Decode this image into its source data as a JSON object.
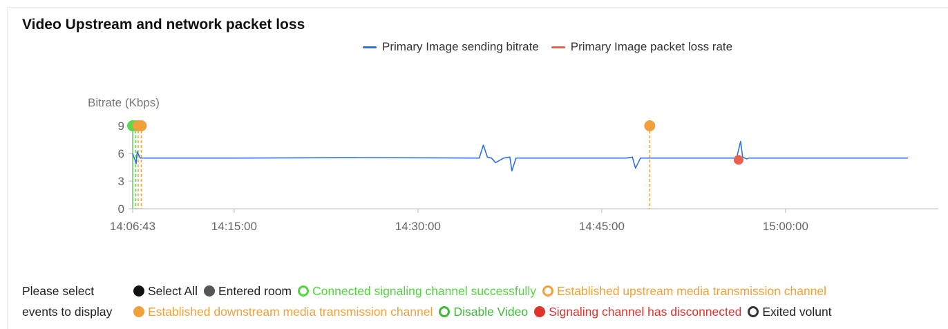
{
  "panel": {
    "title": "Video Upstream and network packet loss"
  },
  "legend": [
    {
      "label": "Primary Image sending bitrate",
      "color": "#2f6fe0"
    },
    {
      "label": "Primary Image packet loss rate",
      "color": "#e8614f"
    }
  ],
  "chart_data": {
    "type": "line",
    "ylabel": "Bitrate (Kbps)",
    "ylim": [
      0,
      9
    ],
    "yticks": [
      0,
      3,
      6,
      9
    ],
    "xlim": [
      "14:06:43",
      "15:10:00"
    ],
    "xticks": [
      "14:06:43",
      "14:15:00",
      "14:30:00",
      "14:45:00",
      "15:00:00"
    ],
    "series": [
      {
        "name": "Primary Image sending bitrate",
        "color": "#2f6fe0",
        "x": [
          "14:06:43",
          "14:07:00",
          "14:07:05",
          "14:07:20",
          "14:08:00",
          "14:15:00",
          "14:25:00",
          "14:35:00",
          "14:35:20",
          "14:35:40",
          "14:36:00",
          "14:36:20",
          "14:37:00",
          "14:37:30",
          "14:37:40",
          "14:38:00",
          "14:45:00",
          "14:47:00",
          "14:47:30",
          "14:47:45",
          "14:48:10",
          "14:50:00",
          "14:55:00",
          "14:56:00",
          "14:56:20",
          "14:56:30",
          "14:56:50",
          "14:57:00",
          "15:00:00",
          "15:05:00",
          "15:10:00"
        ],
        "y": [
          6.0,
          4.9,
          6.2,
          5.5,
          5.5,
          5.5,
          5.55,
          5.5,
          6.9,
          5.6,
          5.5,
          5.0,
          5.5,
          5.6,
          4.1,
          5.5,
          5.5,
          5.5,
          5.6,
          4.4,
          5.5,
          5.5,
          5.5,
          5.5,
          7.3,
          5.6,
          5.4,
          5.5,
          5.5,
          5.5,
          5.5
        ]
      },
      {
        "name": "Primary Image packet loss rate",
        "color": "#e8614f",
        "x": [
          "14:56:10"
        ],
        "y": [
          5.3
        ]
      }
    ],
    "event_markers": [
      {
        "time": "14:06:43",
        "color": "#5dd84c",
        "line": "solid"
      },
      {
        "time": "14:06:57",
        "color": "#5dd84c",
        "line": "dashed"
      },
      {
        "time": "14:07:10",
        "color": "#f0a13a",
        "line": "dashed"
      },
      {
        "time": "14:07:25",
        "color": "#f0a13a",
        "line": "dashed"
      },
      {
        "time": "14:48:55",
        "color": "#f0a13a",
        "line": "dashed"
      }
    ],
    "grid": false
  },
  "events": {
    "label_line1": "Please select",
    "label_line2": "events to display",
    "row1": [
      {
        "label": "Select All",
        "color": "#111111",
        "style": "filled"
      },
      {
        "label": "Entered room",
        "color": "#555555",
        "style": "filled"
      },
      {
        "label": "Connected signaling channel successfully",
        "color": "#52d63e",
        "style": "ring"
      },
      {
        "label": "Established upstream media transmission channel",
        "color": "#f0a13a",
        "style": "ring"
      }
    ],
    "row2": [
      {
        "label": "Established downstream media transmission channel",
        "color": "#f0a13a",
        "style": "filled"
      },
      {
        "label": "Disable Video",
        "color": "#3fb93a",
        "style": "ring"
      },
      {
        "label": "Signaling channel has disconnected",
        "color": "#e0332c",
        "style": "filled"
      },
      {
        "label": "Exited volunt",
        "color": "#333333",
        "style": "ring"
      }
    ]
  }
}
